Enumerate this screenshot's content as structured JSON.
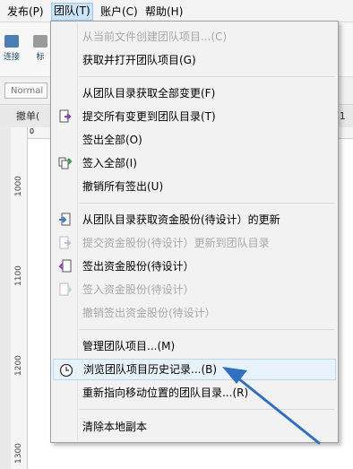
{
  "menubar": {
    "items": [
      "发布(P)",
      "团队(T)",
      "账户(C)",
      "帮助(H)"
    ]
  },
  "toolbar": {
    "buttons": [
      "连接",
      "标"
    ]
  },
  "stylebar": {
    "style_value": "Normal"
  },
  "tabs": {
    "left": "撤单(",
    "right": "e1"
  },
  "ruler": {
    "labels": [
      "1000",
      "1100",
      "1200",
      "1300"
    ],
    "h_zero": "0"
  },
  "menu": {
    "items": [
      {
        "label": "从当前文件创建团队项目...(C)",
        "enabled": false,
        "icon": ""
      },
      {
        "label": "获取并打开团队项目(G)",
        "enabled": true,
        "icon": ""
      },
      {
        "label": "从团队目录获取全部变更(F)",
        "enabled": true,
        "icon": ""
      },
      {
        "label": "提交所有变更到团队目录(T)",
        "enabled": true,
        "icon": "commit-icon"
      },
      {
        "label": "签出全部(O)",
        "enabled": true,
        "icon": ""
      },
      {
        "label": "签入全部(I)",
        "enabled": true,
        "icon": "checkin-all-icon"
      },
      {
        "label": "撤销所有签出(U)",
        "enabled": true,
        "icon": ""
      },
      {
        "label": "从团队目录获取资金股份(待设计）的更新",
        "enabled": true,
        "icon": "get-updates-icon"
      },
      {
        "label": "提交资金股份(待设计）更新到团队目录",
        "enabled": false,
        "icon": "commit-page-icon"
      },
      {
        "label": "签出资金股份(待设计）",
        "enabled": true,
        "icon": "checkout-page-icon"
      },
      {
        "label": "签入资金股份(待设计）",
        "enabled": false,
        "icon": "checkin-page-icon"
      },
      {
        "label": "撤销签出资金股份(待设计）",
        "enabled": false,
        "icon": ""
      },
      {
        "label": "管理团队项目...(M)",
        "enabled": true,
        "icon": ""
      },
      {
        "label": "浏览团队项目历史记录...(B)",
        "enabled": true,
        "icon": "clock-icon",
        "highlighted": true
      },
      {
        "label": "重新指向移动位置的团队目录...(R)",
        "enabled": true,
        "icon": ""
      },
      {
        "label": "清除本地副本",
        "enabled": true,
        "icon": ""
      }
    ]
  },
  "colors": {
    "highlight": "#e8f2fb",
    "arrow": "#2f6fc4",
    "active_menu": "#cce4f7"
  }
}
